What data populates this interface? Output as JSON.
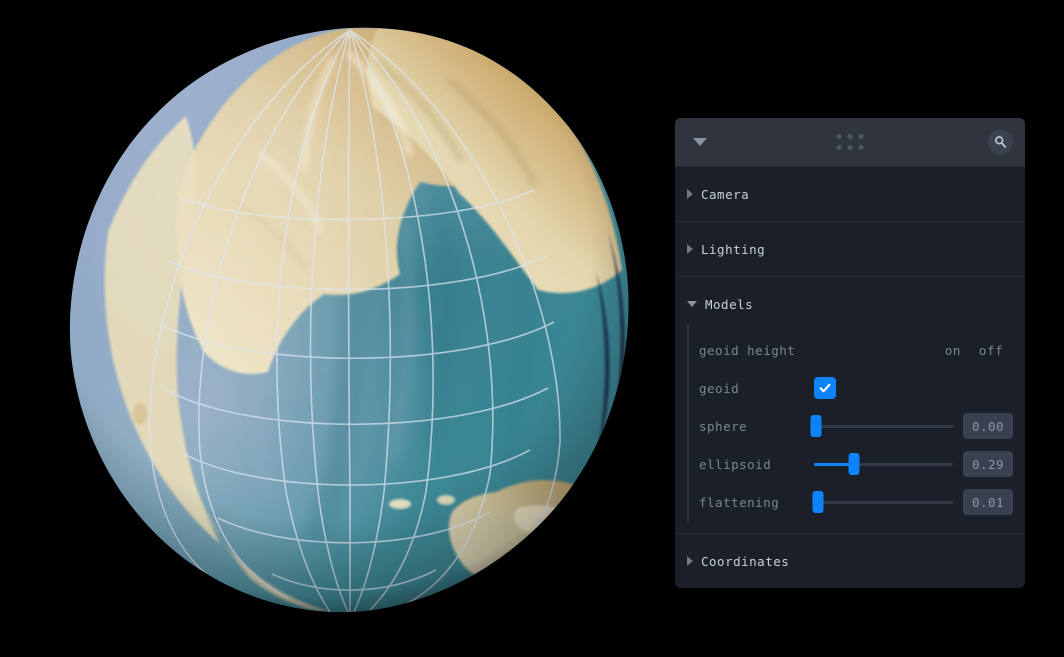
{
  "app": {
    "background_color": "#000000",
    "accent_color": "#0d84fe",
    "panel_color": "#1b1f27",
    "panel_header_color": "#2f343f"
  },
  "viewport": {
    "name": "geoid-globe-viewport",
    "description": "3D geoid globe render",
    "ocean_colors": [
      "#2f7f8c",
      "#7f96b8",
      "#9aa9c6",
      "#4f93a0"
    ],
    "land_colors": [
      "#e8dcb8",
      "#d7c496",
      "#b98b47",
      "#a8742f"
    ],
    "graticule_color": "#d9e2ef"
  },
  "panel": {
    "header": {
      "collapse_icon": "triangle-down-icon",
      "drag_icon": "drag-dots-icon",
      "search_icon": "magnifier-icon"
    },
    "folders": [
      {
        "label": "Camera",
        "expanded": false,
        "icon": "triangle-right-icon"
      },
      {
        "label": "Lighting",
        "expanded": false,
        "icon": "triangle-right-icon"
      },
      {
        "label": "Models",
        "expanded": true,
        "icon": "triangle-down-icon"
      },
      {
        "label": "Coordinates",
        "expanded": false,
        "icon": "triangle-right-icon"
      }
    ],
    "models": {
      "geoid_height": {
        "label": "geoid height",
        "on_label": "on",
        "off_label": "off"
      },
      "geoid": {
        "label": "geoid",
        "checked": true,
        "check_icon": "checkmark-icon"
      },
      "sliders": [
        {
          "label": "sphere",
          "value": "0.00",
          "percent": 1.5
        },
        {
          "label": "ellipsoid",
          "value": "0.29",
          "percent": 29
        },
        {
          "label": "flattening",
          "value": "0.01",
          "percent": 3
        }
      ]
    }
  }
}
